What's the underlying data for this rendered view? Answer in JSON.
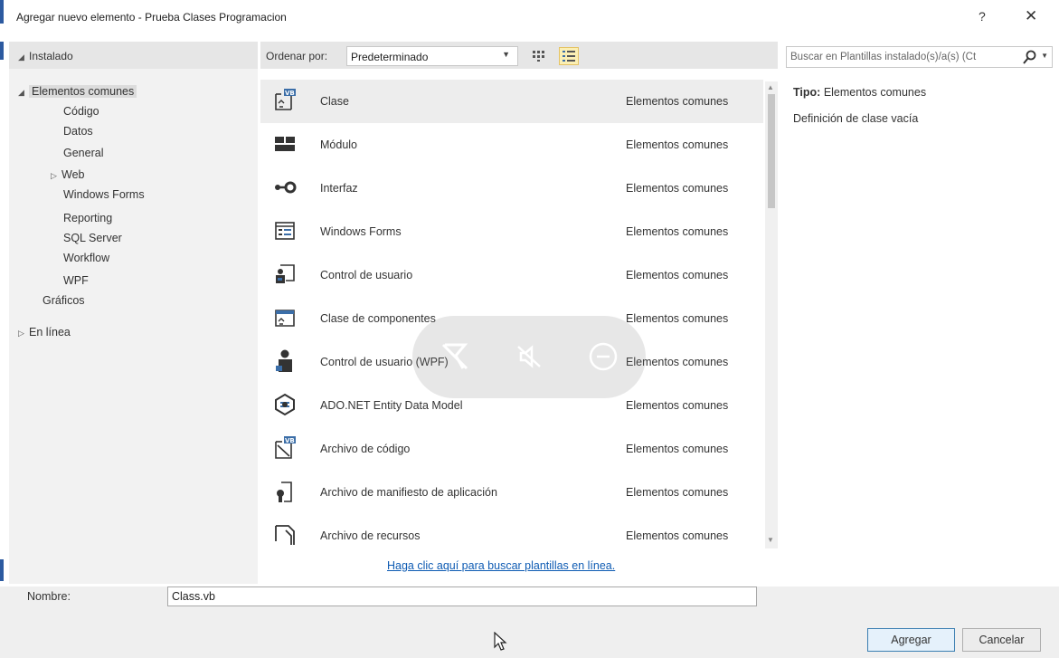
{
  "window": {
    "title": "Agregar nuevo elemento - Prueba Clases Programacion",
    "help_label": "?",
    "close_label": "✕"
  },
  "left": {
    "installed_label": "Instalado",
    "tree": {
      "common": "Elementos comunes",
      "codigo": "Código",
      "datos": "Datos",
      "general": "General",
      "web": "Web",
      "winforms": "Windows Forms",
      "reporting": "Reporting",
      "sql": "SQL Server",
      "workflow": "Workflow",
      "wpf": "WPF",
      "graficos": "Gráficos",
      "online": "En línea"
    }
  },
  "middle": {
    "sort_label": "Ordenar por:",
    "sort_value": "Predeterminado",
    "items": [
      {
        "name": "Clase",
        "category": "Elementos comunes",
        "icon": "vb-class-icon"
      },
      {
        "name": "Módulo",
        "category": "Elementos comunes",
        "icon": "module-icon"
      },
      {
        "name": "Interfaz",
        "category": "Elementos comunes",
        "icon": "interface-icon"
      },
      {
        "name": "Windows Forms",
        "category": "Elementos comunes",
        "icon": "windows-form-icon"
      },
      {
        "name": "Control de usuario",
        "category": "Elementos comunes",
        "icon": "user-control-icon"
      },
      {
        "name": "Clase de componentes",
        "category": "Elementos comunes",
        "icon": "component-class-icon"
      },
      {
        "name": "Control de usuario (WPF)",
        "category": "Elementos comunes",
        "icon": "wpf-user-control-icon"
      },
      {
        "name": "ADO.NET Entity Data Model",
        "category": "Elementos comunes",
        "icon": "entity-data-model-icon"
      },
      {
        "name": "Archivo de código",
        "category": "Elementos comunes",
        "icon": "vb-code-file-icon"
      },
      {
        "name": "Archivo de manifiesto de aplicación",
        "category": "Elementos comunes",
        "icon": "manifest-file-icon"
      },
      {
        "name": "Archivo de recursos",
        "category": "Elementos comunes",
        "icon": "resource-file-icon"
      }
    ],
    "online_link": "Haga clic aquí para buscar plantillas en línea."
  },
  "right": {
    "search_placeholder": "Buscar en Plantillas instalado(s)/a(s) (Ct",
    "type_label": "Tipo:",
    "type_value": "Elementos comunes",
    "description": "Definición de clase vacía"
  },
  "bottom": {
    "name_label": "Nombre:",
    "name_value": "Class.vb",
    "add_label": "Agregar",
    "cancel_label": "Cancelar"
  },
  "colors": {
    "link": "#0e5bb3",
    "panel": "#f2f2f2",
    "header": "#e6e6e6",
    "accent": "#2c5aa0"
  }
}
